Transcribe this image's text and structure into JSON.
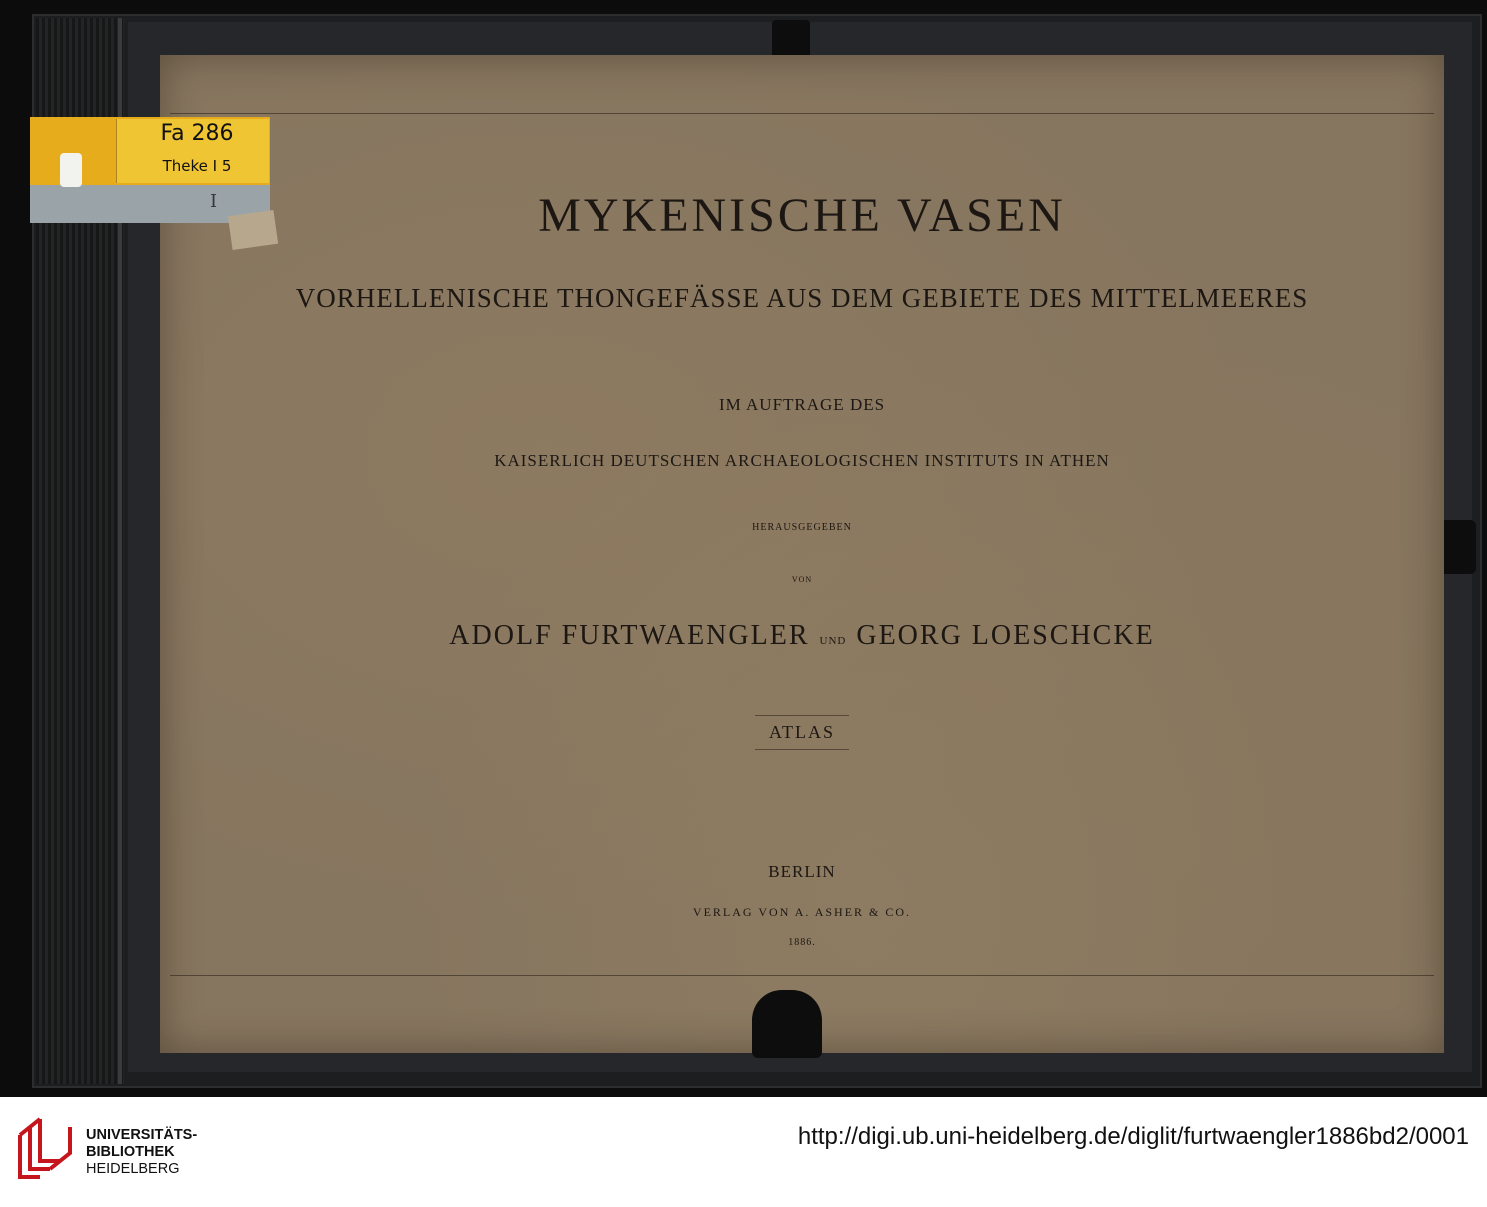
{
  "cover": {
    "title": "MYKENISCHE VASEN",
    "subtitle": "VORHELLENISCHE THONGEFÄSSE AUS DEM GEBIETE DES MITTELMEERES",
    "commission": "IM AUFTRAGE DES",
    "institute": "KAISERLICH DEUTSCHEN ARCHAEOLOGISCHEN INSTITUTS IN ATHEN",
    "edited": "HERAUSGEGEBEN",
    "by": "VON",
    "author1": "ADOLF FURTWAENGLER",
    "and": "UND",
    "author2": "GEORG LOESCHCKE",
    "volume": "ATLAS",
    "city": "BERLIN",
    "publisher": "VERLAG VON A. ASHER & CO.",
    "year": "1886."
  },
  "shelf_label": {
    "line1": "Fa 286",
    "line2": "Theke I 5",
    "mark": "I"
  },
  "footer": {
    "logo_line1": "UNIVERSITÄTS-",
    "logo_line2": "BIBLIOTHEK",
    "logo_line3": "HEIDELBERG",
    "url": "http://digi.ub.uni-heidelberg.de/diglit/furtwaengler1886bd2/0001"
  },
  "colors": {
    "logo_red": "#c4161c",
    "paper": "#87765f",
    "label_yellow": "#e6ac1b",
    "label_blue": "#9aa4a8"
  }
}
